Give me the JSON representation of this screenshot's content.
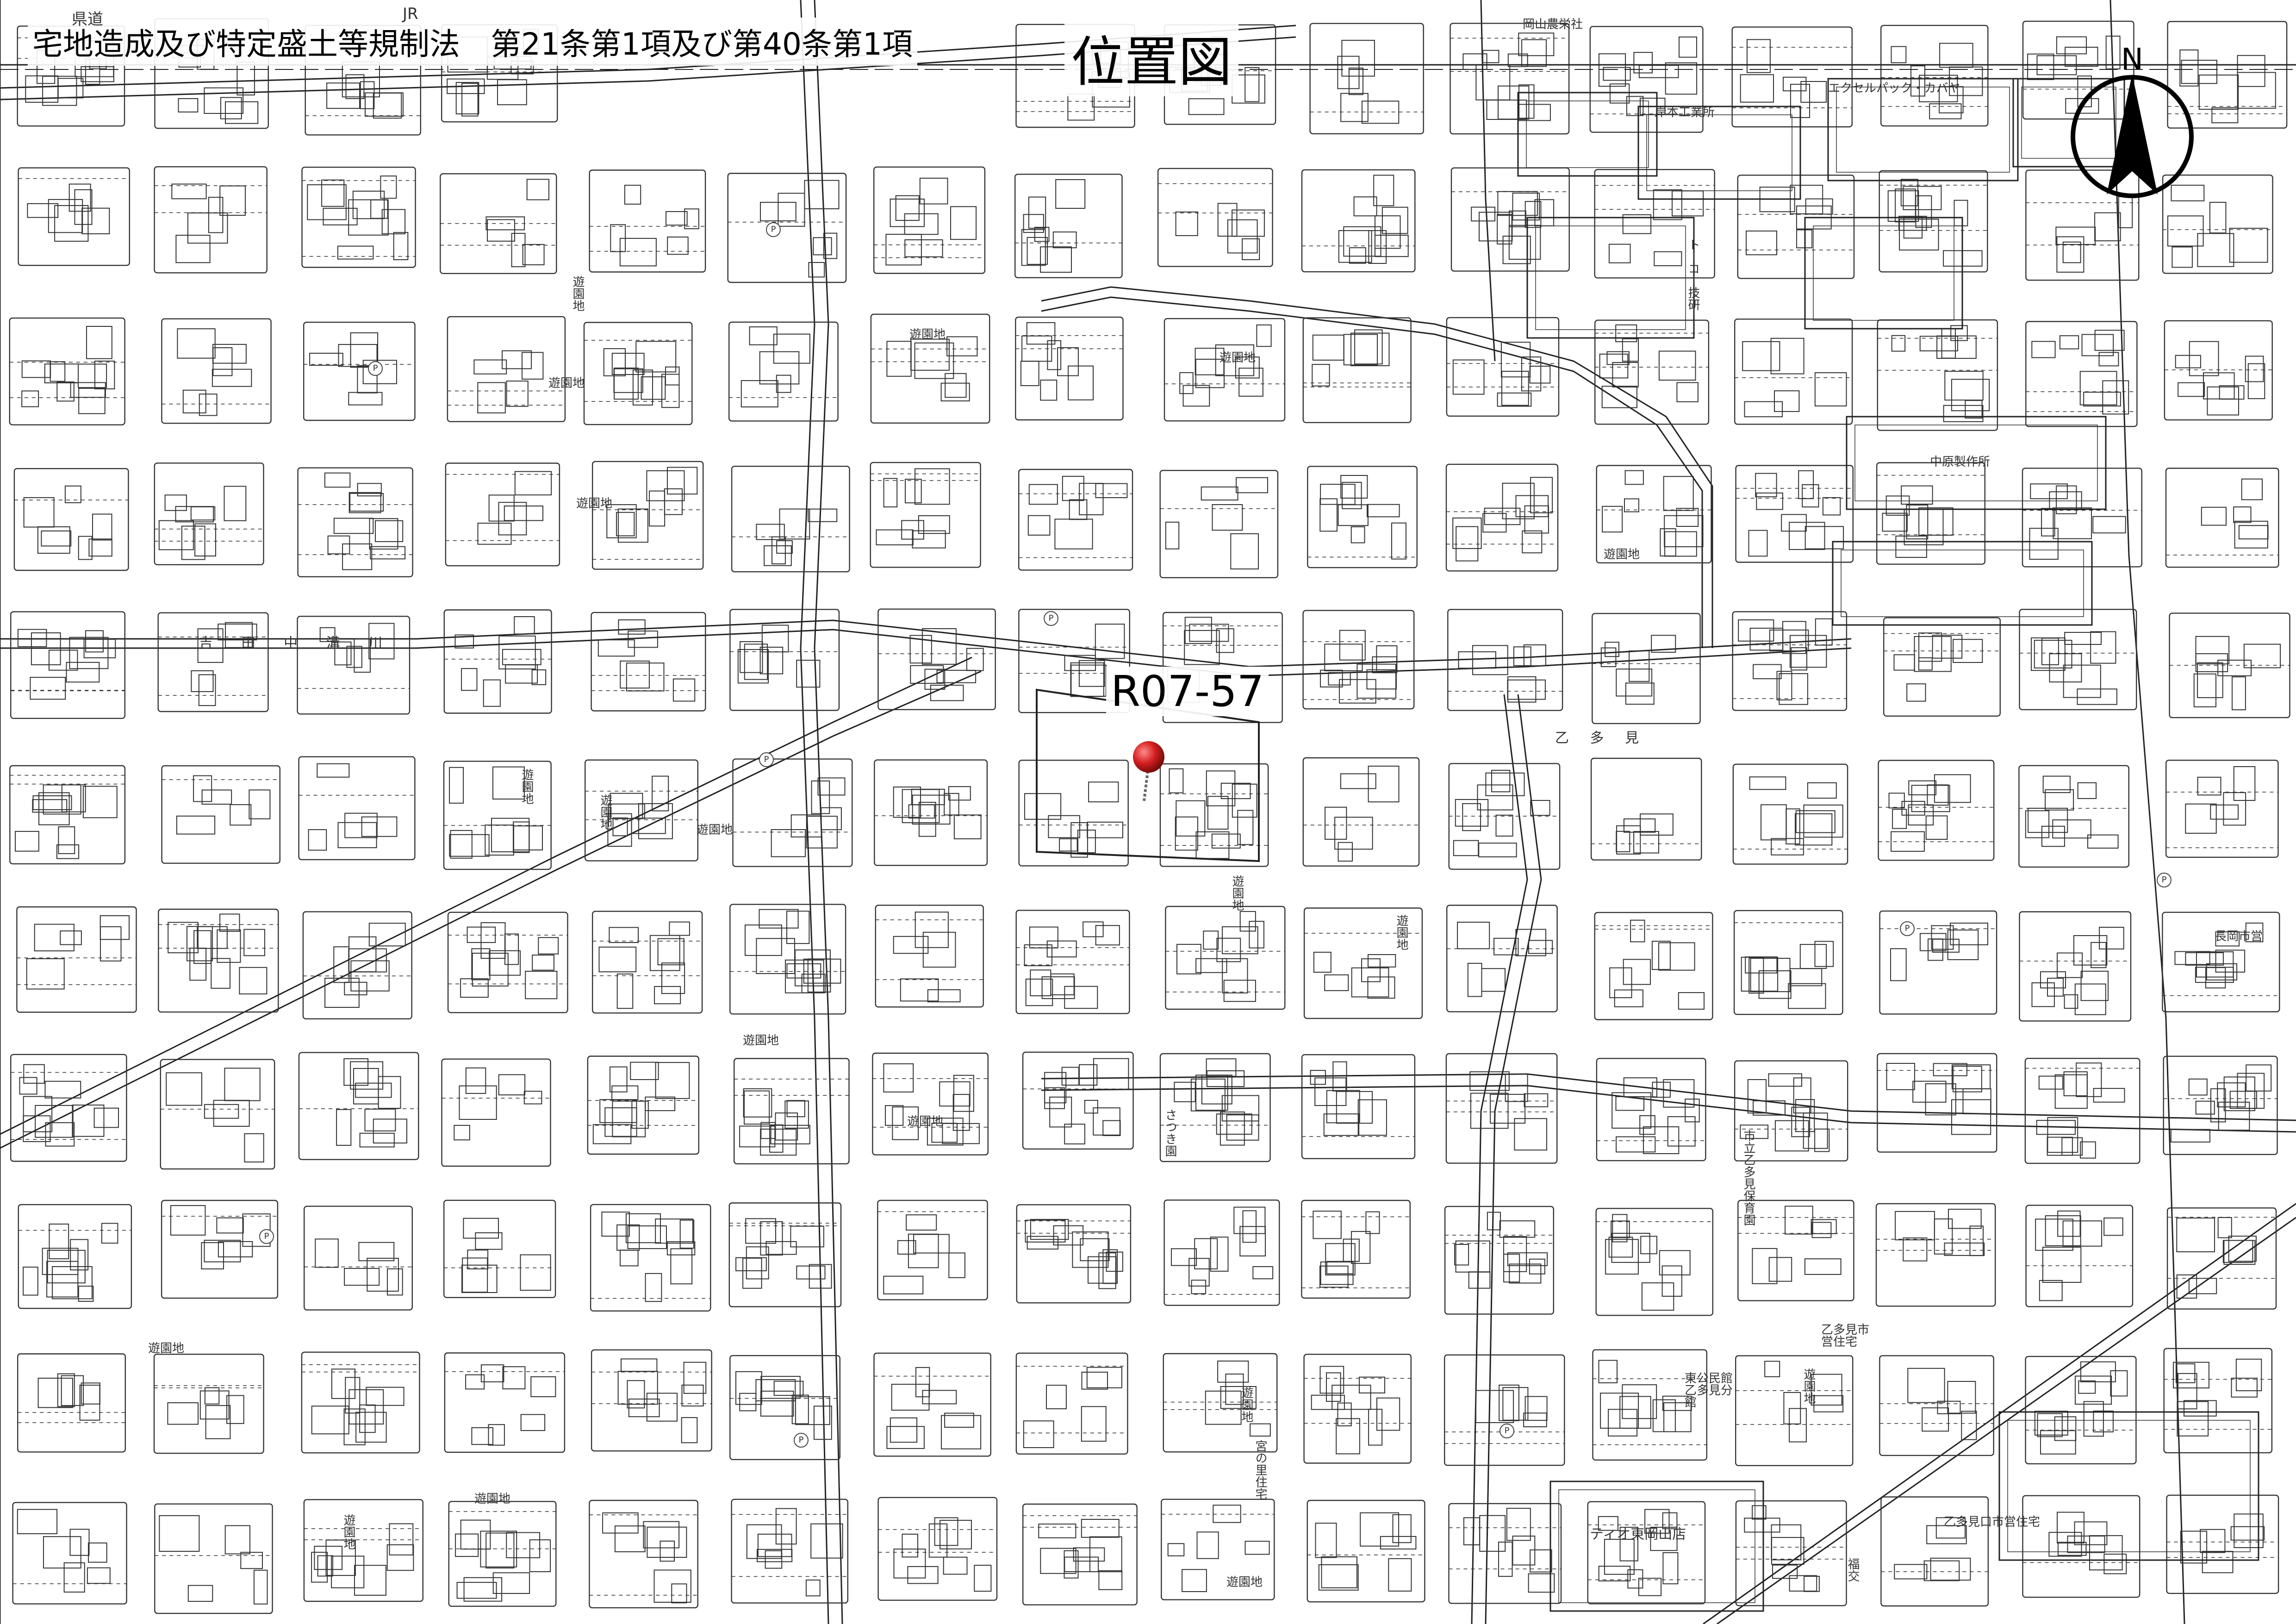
{
  "header": {
    "law_title": "宅地造成及び特定盛土等規制法　第21条第1項及び第40条第1項",
    "map_title": "位置図"
  },
  "north_arrow": {
    "letter": "N"
  },
  "site": {
    "label": "R07-57",
    "marker_color": "#d41f1f"
  },
  "labels": {
    "rail_jr": "JR",
    "road_prefecture": "県道",
    "area_otakemi": "乙 多 見",
    "river_yoshida": "吉 田 中 溝 川",
    "okayama_agri": "岡山農栄社",
    "excel_pack": "エクセルパック・カバヤ",
    "kishimoto": "岸本工業所",
    "tokou": "トーコー技研",
    "nakahara": "中原製作所",
    "satsuki": "さつき園",
    "nursery": "市立乙多見保育園",
    "tio": "ティオ東岡山店",
    "community_hall": "東公民館乙多見分館",
    "municipal_housing_1": "乙多見市営住宅",
    "municipal_housing_2": "乙多見口市営住宅",
    "nagaoka_housing": "長岡市営",
    "fukko": "福交",
    "sanomiya_housing": "宮の里住宅",
    "playground": "遊園地"
  },
  "colors": {
    "ink": "#111111",
    "road_fill": "#ffffff",
    "block_line": "#222222",
    "marker": "#d41f1f"
  }
}
